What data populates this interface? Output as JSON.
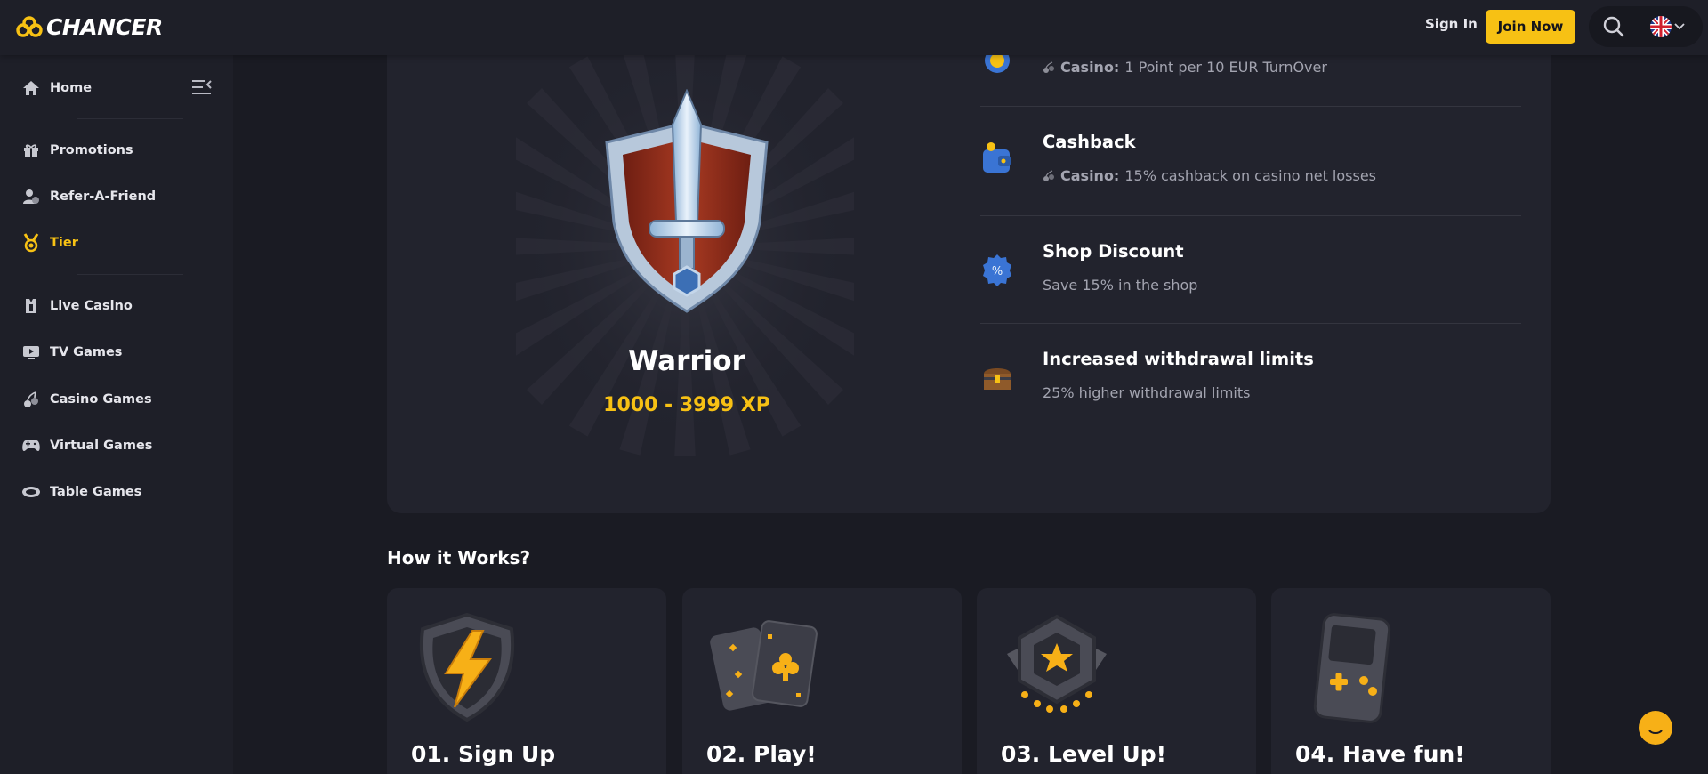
{
  "brand": {
    "name": "CHANCER",
    "accent": "#f7c114"
  },
  "header": {
    "sign_in": "Sign In",
    "join_now": "Join Now"
  },
  "sidebar": {
    "items": [
      {
        "label": "Home",
        "icon": "home-icon"
      },
      {
        "label": "Promotions",
        "icon": "gift-icon"
      },
      {
        "label": "Refer-A-Friend",
        "icon": "refer-friend-icon"
      },
      {
        "label": "Tier",
        "icon": "medal-icon",
        "active": true
      },
      {
        "label": "Live Casino",
        "icon": "live-casino-icon"
      },
      {
        "label": "TV Games",
        "icon": "tv-icon"
      },
      {
        "label": "Casino Games",
        "icon": "cherries-icon"
      },
      {
        "label": "Virtual Games",
        "icon": "gamepad-icon"
      },
      {
        "label": "Table Games",
        "icon": "table-icon"
      }
    ]
  },
  "tier": {
    "name": "Warrior",
    "xp_range": "1000 - 3999 XP"
  },
  "benefits": [
    {
      "title": "",
      "tag": "Casino:",
      "desc": "1 Point per 10 EUR TurnOver",
      "icon": "points-icon"
    },
    {
      "title": "Cashback",
      "tag": "Casino:",
      "desc": "15% cashback on casino net losses",
      "icon": "wallet-icon"
    },
    {
      "title": "Shop Discount",
      "tag": "",
      "desc": "Save 15% in the shop",
      "icon": "discount-badge-icon"
    },
    {
      "title": "Increased withdrawal limits",
      "tag": "",
      "desc": "25% higher withdrawal limits",
      "icon": "chest-icon"
    }
  ],
  "how_it_works": {
    "title": "How it Works?",
    "steps": [
      {
        "label": "01. Sign Up",
        "icon": "lightning-shield-icon"
      },
      {
        "label": "02. Play!",
        "icon": "cards-icon"
      },
      {
        "label": "03. Level Up!",
        "icon": "star-badge-icon"
      },
      {
        "label": "04. Have fun!",
        "icon": "handheld-console-icon"
      }
    ]
  }
}
